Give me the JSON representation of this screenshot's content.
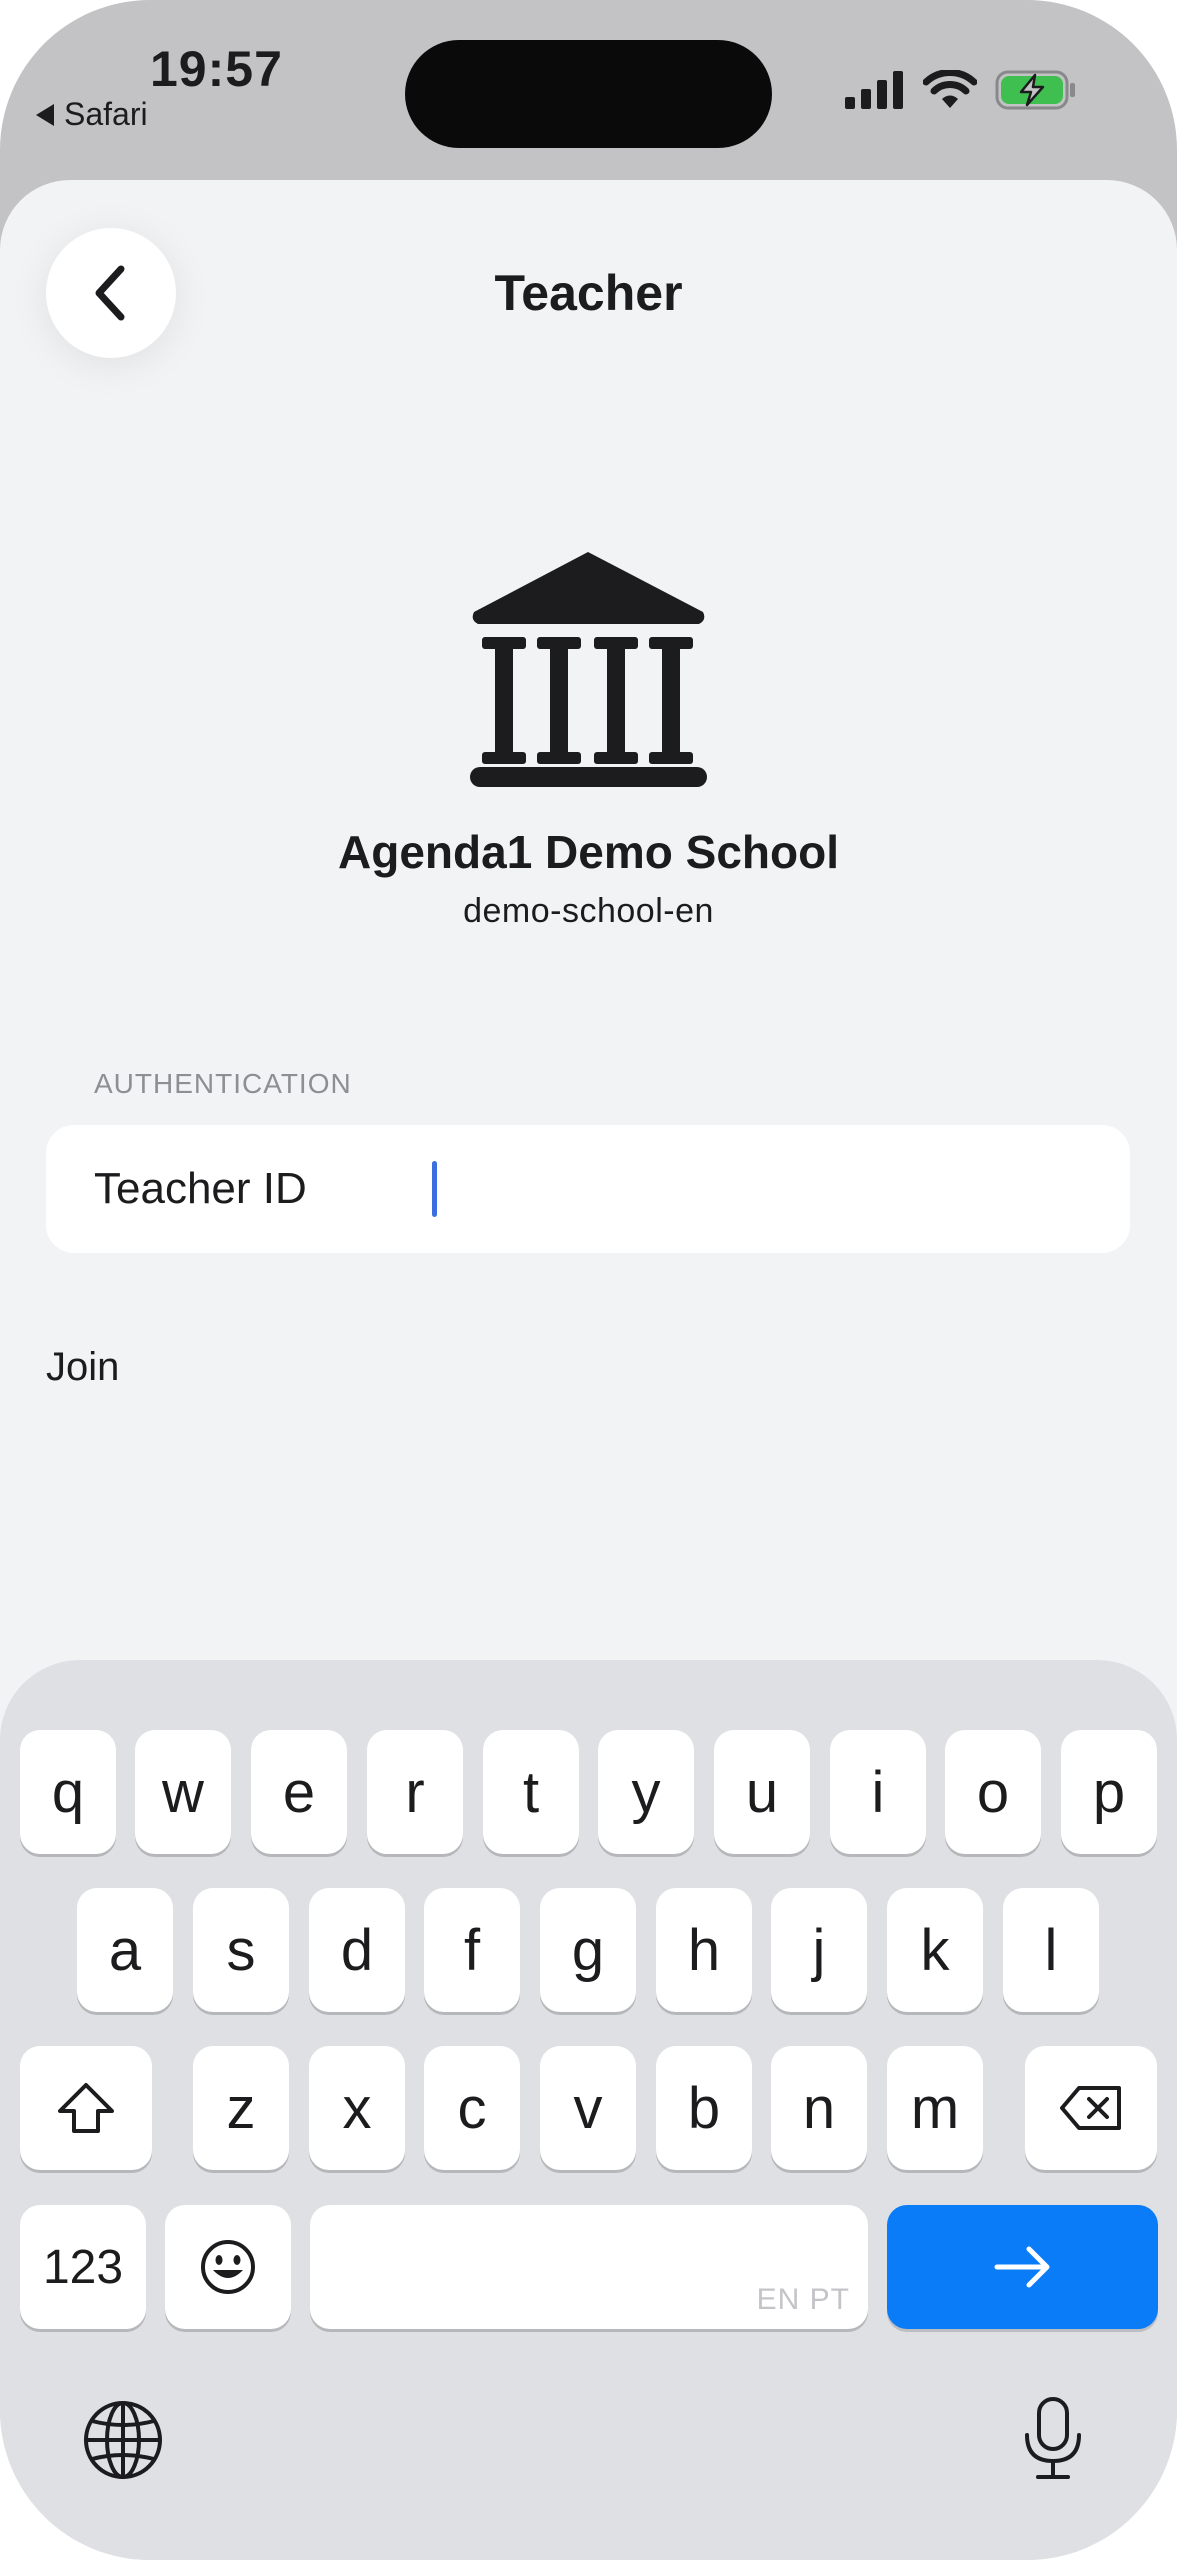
{
  "status_bar": {
    "time": "19:57",
    "back_app": "Safari",
    "icons": [
      "cellular-signal-icon",
      "wifi-icon",
      "battery-charging-icon"
    ]
  },
  "nav": {
    "title": "Teacher",
    "back_icon": "chevron-left-icon"
  },
  "school": {
    "icon": "bank-building-icon",
    "name": "Agenda1 Demo School",
    "slug": "demo-school-en"
  },
  "form": {
    "section_header": "AUTHENTICATION",
    "teacher_id_label": "Teacher ID",
    "teacher_id_value": "",
    "join_label": "Join"
  },
  "keyboard": {
    "row1": [
      "q",
      "w",
      "e",
      "r",
      "t",
      "y",
      "u",
      "i",
      "o",
      "p"
    ],
    "row2": [
      "a",
      "s",
      "d",
      "f",
      "g",
      "h",
      "j",
      "k",
      "l"
    ],
    "row3": [
      "z",
      "x",
      "c",
      "v",
      "b",
      "n",
      "m"
    ],
    "numbers_label": "123",
    "space_languages": "EN PT",
    "accent_color": "#0a7cf7"
  }
}
